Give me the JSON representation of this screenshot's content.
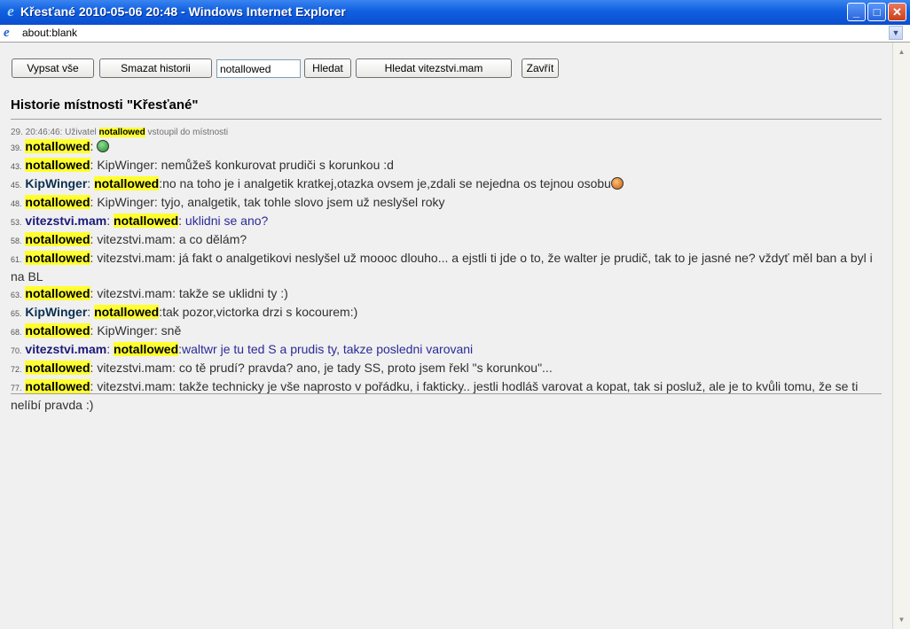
{
  "window": {
    "title": "Křesťané 2010-05-06 20:48 - Windows Internet Explorer",
    "url": "about:blank"
  },
  "toolbar": {
    "list_all": "Vypsat vše",
    "clear_history": "Smazat historii",
    "search_value": "notallowed",
    "search": "Hledat",
    "search_user": "Hledat vitezstvi.mam",
    "close": "Zavřít"
  },
  "heading": "Historie místnosti \"Křesťané\"",
  "system": {
    "ts": "29. 20:46:46:",
    "pre": "Uživatel",
    "nick": "notallowed",
    "post": "vstoupil do místnosti"
  },
  "messages": [
    {
      "ts": "39.",
      "nick": "notallowed",
      "sep": ":",
      "text": "",
      "smiley": "green-smiley"
    },
    {
      "ts": "43.",
      "nick": "notallowed",
      "sep": ":",
      "text": "KipWinger: nemůžeš konkurovat prudiči s korunkou :d"
    },
    {
      "ts": "45.",
      "nick": "KipWinger",
      "sep": ":",
      "to": "notallowed",
      "sep2": ":",
      "text": "no na toho je i analgetik kratkej,otazka ovsem je,zdali se nejedna os tejnou osobu",
      "smiley": "orange-smiley"
    },
    {
      "ts": "48.",
      "nick": "notallowed",
      "sep": ":",
      "text": "KipWinger: tyjo, analgetik, tak tohle slovo jsem už neslyšel roky"
    },
    {
      "ts": "53.",
      "nick": "vitezstvi.mam",
      "sep": ":",
      "to": "notallowed",
      "sep2": ":",
      "text": "uklidni se ano?"
    },
    {
      "ts": "58.",
      "nick": "notallowed",
      "sep": ":",
      "text": "vitezstvi.mam: a co dělám?"
    },
    {
      "ts": "61.",
      "nick": "notallowed",
      "sep": ":",
      "text": "vitezstvi.mam: já fakt o analgetikovi neslyšel už moooc dlouho... a ejstli ti jde o to, že walter je prudič, tak to je jasné ne? vždyť měl ban a byl i na BL"
    },
    {
      "ts": "63.",
      "nick": "notallowed",
      "sep": ":",
      "text": "vitezstvi.mam: takže se uklidni ty :)"
    },
    {
      "ts": "65.",
      "nick": "KipWinger",
      "sep": ":",
      "to": "notallowed",
      "sep2": ":",
      "text": "tak pozor,victorka drzi s kocourem:)"
    },
    {
      "ts": "68.",
      "nick": "notallowed",
      "sep": ":",
      "text": "KipWinger: sně"
    },
    {
      "ts": "70.",
      "nick": "vitezstvi.mam",
      "sep": ":",
      "to": "notallowed",
      "sep2": ":",
      "text": "waltwr je tu ted S a prudis ty, takze posledni varovani"
    },
    {
      "ts": "72.",
      "nick": "notallowed",
      "sep": ":",
      "text": "vitezstvi.mam: co tě prudí? pravda? ano, je tady SS, proto jsem řekl \"s korunkou\"..."
    },
    {
      "ts": "77.",
      "nick": "notallowed",
      "sep": ":",
      "text": "vitezstvi.mam: takže technicky je vše naprosto v pořádku, i fakticky.. jestli hodláš varovat a kopat, tak si posluž, ale je to kvůli tomu, že se ti nelíbí pravda :)"
    }
  ]
}
